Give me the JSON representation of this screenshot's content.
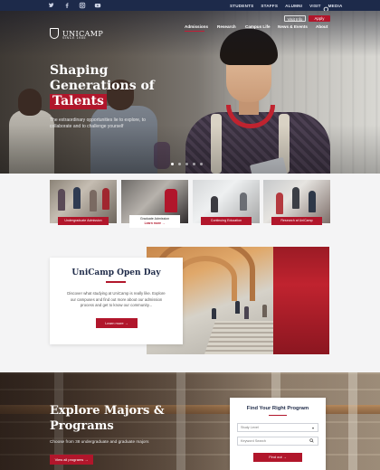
{
  "utility_bar": {
    "social": [
      "twitter-icon",
      "facebook-icon",
      "instagram-icon",
      "youtube-icon"
    ],
    "links": [
      "STUDENTS",
      "STAFFS",
      "ALUMNI",
      "VISIT",
      "MEDIA"
    ]
  },
  "brand": {
    "name": "UNICAMP",
    "since": "SINCE 1985"
  },
  "header_ctas": {
    "visit": "Visit Info",
    "apply": "Apply"
  },
  "nav": {
    "items": [
      "Admissions",
      "Research",
      "Campus Life",
      "News & Events",
      "About"
    ],
    "active": "Admissions"
  },
  "hero": {
    "title_line1": "Shaping",
    "title_line2": "Generations of",
    "title_highlight": "Talents",
    "subtitle": "The extraordinary opportunities lie to explore, to collaborate and to challenge yourself",
    "slides": 5,
    "active_slide": 1
  },
  "categories": [
    {
      "label": "Undergraduate Admission"
    },
    {
      "label": "Graduate Admission",
      "more": "Learn more →"
    },
    {
      "label": "Continuing Education"
    },
    {
      "label": "Research at UniCamp"
    }
  ],
  "open_day": {
    "title": "UniCamp Open Day",
    "text": "Discover what studying at UniCamp is really like. Explore our campuses and find out more about our admission process and get to know our community...",
    "button": "Learn more →"
  },
  "explore": {
    "title_line1": "Explore Majors &",
    "title_line2": "Programs",
    "subtitle": "Choose from 38 undergraduate and graduate majors",
    "button": "View all programs →"
  },
  "program_finder": {
    "title": "Find Your Right Program",
    "select_value": "Study Level",
    "search_placeholder": "Keyword Search",
    "button": "Find out →"
  },
  "colors": {
    "brand_red": "#b1162b",
    "navy": "#1d2a4a"
  }
}
